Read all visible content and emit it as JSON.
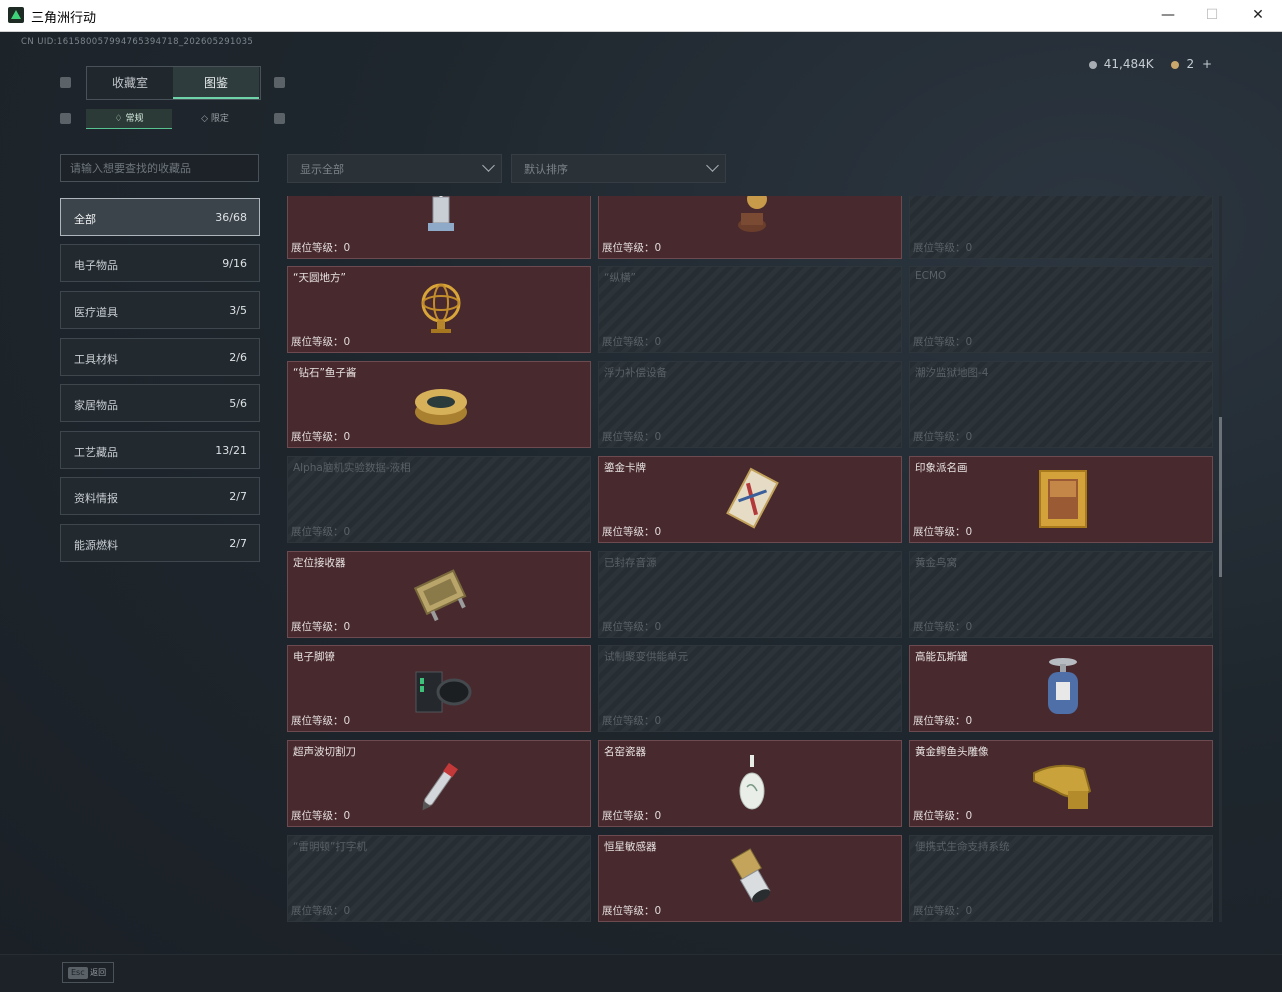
{
  "window": {
    "title": "三角洲行动",
    "minimize": "—",
    "maximize": "☐",
    "close": "✕"
  },
  "uid": "CN UID:1615800579947653947​18_202605291035",
  "currency": {
    "silver": "41,484K",
    "gold": "2",
    "plus": "+"
  },
  "tabs": {
    "collection_room": "收藏室",
    "catalog": "图鉴"
  },
  "subtabs": {
    "regular": "常规",
    "limited": "限定"
  },
  "search": {
    "placeholder": "请输入想要查找的收藏品"
  },
  "filters": {
    "show": "显示全部",
    "sort": "默认排序"
  },
  "categories": [
    {
      "label": "全部",
      "count": "36/68"
    },
    {
      "label": "电子物品",
      "count": "9/16"
    },
    {
      "label": "医疗道具",
      "count": "3/5"
    },
    {
      "label": "工具材料",
      "count": "2/6"
    },
    {
      "label": "家居物品",
      "count": "5/6"
    },
    {
      "label": "工艺藏品",
      "count": "13/21"
    },
    {
      "label": "资料情报",
      "count": "2/7"
    },
    {
      "label": "能源燃料",
      "count": "2/7"
    }
  ],
  "items": [
    {
      "name": "",
      "level": "展位等级：0",
      "collected": true
    },
    {
      "name": "",
      "level": "展位等级：0",
      "collected": true
    },
    {
      "name": "",
      "level": "展位等级：0",
      "collected": false
    },
    {
      "name": "“天圆地方”",
      "level": "展位等级：0",
      "collected": true
    },
    {
      "name": "“纵横”",
      "level": "展位等级：0",
      "collected": false
    },
    {
      "name": "ECMO",
      "level": "展位等级：0",
      "collected": false
    },
    {
      "name": "“钻石”鱼子酱",
      "level": "展位等级：0",
      "collected": true
    },
    {
      "name": "浮力补偿设备",
      "level": "展位等级：0",
      "collected": false
    },
    {
      "name": "潮汐监狱地图-4",
      "level": "展位等级：0",
      "collected": false
    },
    {
      "name": "Alpha脑机实验数据-液相",
      "level": "展位等级：0",
      "collected": false
    },
    {
      "name": "鎏金卡牌",
      "level": "展位等级：0",
      "collected": true
    },
    {
      "name": "印象派名画",
      "level": "展位等级：0",
      "collected": true
    },
    {
      "name": "定位接收器",
      "level": "展位等级：0",
      "collected": true
    },
    {
      "name": "已封存音源",
      "level": "展位等级：0",
      "collected": false
    },
    {
      "name": "黄金鸟窝",
      "level": "展位等级：0",
      "collected": false
    },
    {
      "name": "电子脚镣",
      "level": "展位等级：0",
      "collected": true
    },
    {
      "name": "试制聚变供能单元",
      "level": "展位等级：0",
      "collected": false
    },
    {
      "name": "高能瓦斯罐",
      "level": "展位等级：0",
      "collected": true
    },
    {
      "name": "超声波切割刀",
      "level": "展位等级：0",
      "collected": true
    },
    {
      "name": "名窑瓷器",
      "level": "展位等级：0",
      "collected": true
    },
    {
      "name": "黄金鳄鱼头雕像",
      "level": "展位等级：0",
      "collected": true
    },
    {
      "name": "“雷明顿”打字机",
      "level": "展位等级：0",
      "collected": false
    },
    {
      "name": "恒星敏感器",
      "level": "展位等级：0",
      "collected": true
    },
    {
      "name": "便携式生命支持系统",
      "level": "展位等级：0",
      "collected": false
    }
  ],
  "footer": {
    "esc_key": "Esc",
    "esc_label": "返回"
  }
}
